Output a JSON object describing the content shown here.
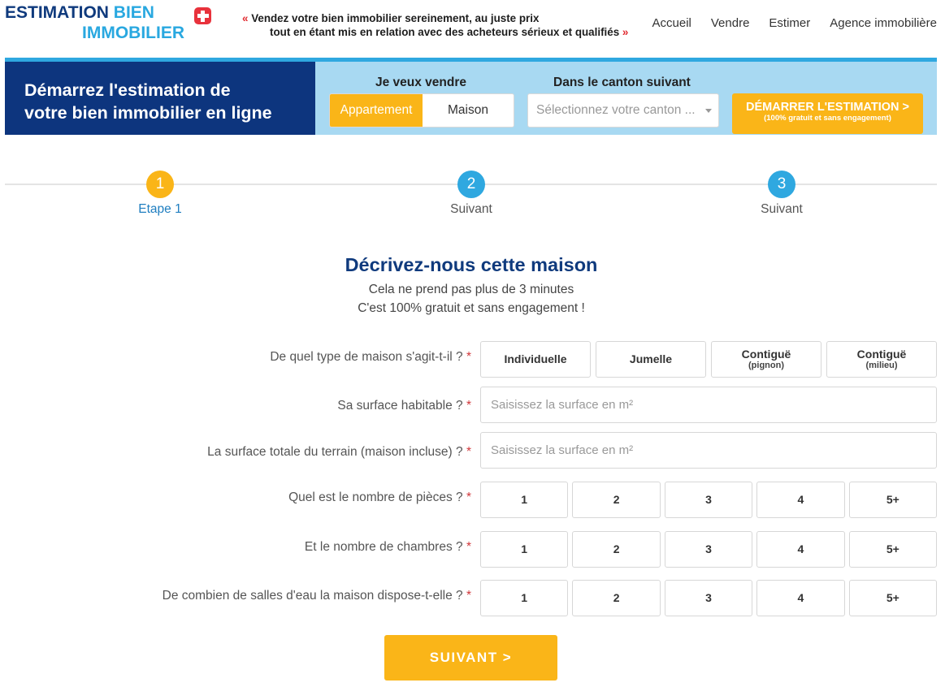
{
  "header": {
    "logo_line1": "ESTIMATION",
    "logo_line1_accent": "BIEN",
    "logo_line2": "IMMOBILIER",
    "tagline_open_quote": "«",
    "tagline_line1": "Vendez votre bien immobilier sereinement, au juste prix",
    "tagline_line2": "tout en étant mis en relation avec des acheteurs sérieux et qualifiés",
    "tagline_close_quote": "»",
    "nav": [
      "Accueil",
      "Vendre",
      "Estimer",
      "Agence immobilière"
    ]
  },
  "banner": {
    "title_line1": "Démarrez l'estimation de",
    "title_line2": "votre bien immobilier en ligne",
    "sell_label": "Je veux vendre",
    "type_options": [
      "Appartement",
      "Maison"
    ],
    "canton_label": "Dans le canton suivant",
    "canton_placeholder": "Sélectionnez votre canton ...",
    "start_label": "DÉMARRER L'ESTIMATION >",
    "start_sublabel": "(100% gratuit et sans engagement)"
  },
  "stepper": {
    "steps": [
      {
        "number": "1",
        "label": "Etape 1"
      },
      {
        "number": "2",
        "label": "Suivant"
      },
      {
        "number": "3",
        "label": "Suivant"
      }
    ]
  },
  "form": {
    "title": "Décrivez-nous cette maison",
    "subtitle1": "Cela ne prend pas plus de 3 minutes",
    "subtitle2": "C'est 100% gratuit et sans engagement !",
    "required_mark": "*",
    "house_type": {
      "label": "De quel type de maison s'agit-t-il ?",
      "options": [
        {
          "label": "Individuelle",
          "sub": ""
        },
        {
          "label": "Jumelle",
          "sub": ""
        },
        {
          "label": "Contiguë",
          "sub": "(pignon)"
        },
        {
          "label": "Contiguë",
          "sub": "(milieu)"
        }
      ]
    },
    "living_area": {
      "label": "Sa surface habitable ?",
      "placeholder": "Saisissez la surface en m²"
    },
    "land_area": {
      "label": "La surface totale du terrain (maison incluse) ?",
      "placeholder": "Saisissez la surface en m²"
    },
    "rooms": {
      "label": "Quel est le nombre de pièces ?",
      "options": [
        "1",
        "2",
        "3",
        "4",
        "5+"
      ]
    },
    "bedrooms": {
      "label": "Et le nombre de chambres ?",
      "options": [
        "1",
        "2",
        "3",
        "4",
        "5+"
      ]
    },
    "bathrooms": {
      "label": "De combien de salles d'eau la maison dispose-t-elle ?",
      "options": [
        "1",
        "2",
        "3",
        "4",
        "5+"
      ]
    },
    "next_label": "SUIVANT >"
  }
}
